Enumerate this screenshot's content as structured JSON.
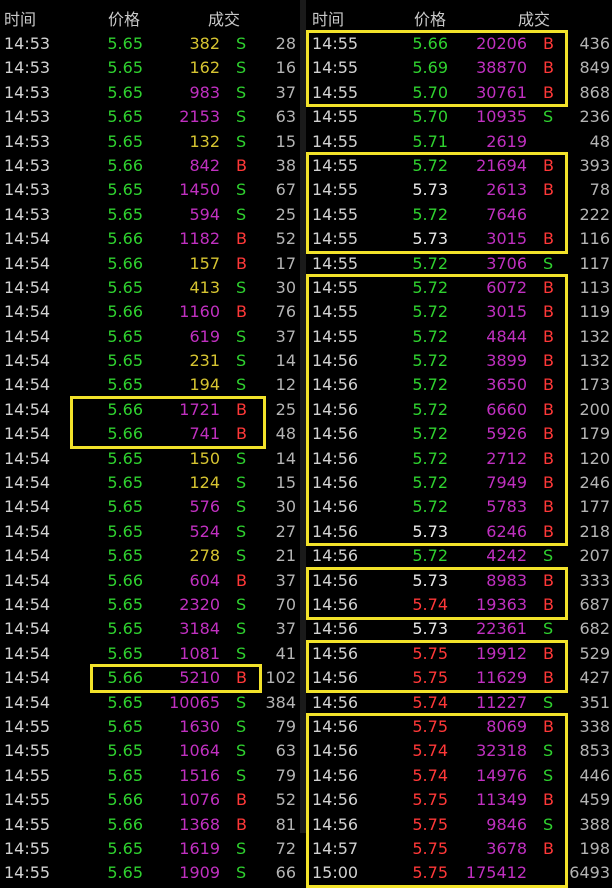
{
  "headers": {
    "time": "时间",
    "price": "价格",
    "volume": "成交"
  },
  "colors": {
    "up": "#ff3838",
    "down": "#2fd12f",
    "flat": "#e8e8e8",
    "vol_small": "#d6c431",
    "vol_large": "#c030c0",
    "side_b": "#ff3838",
    "side_s": "#2fd12f",
    "highlight": "#f2e22a"
  },
  "left_rows": [
    {
      "time": "14:53",
      "price": "5.65",
      "volume": "382",
      "side": "S",
      "count": "28"
    },
    {
      "time": "14:53",
      "price": "5.65",
      "volume": "162",
      "side": "S",
      "count": "16"
    },
    {
      "time": "14:53",
      "price": "5.65",
      "volume": "983",
      "side": "S",
      "count": "37"
    },
    {
      "time": "14:53",
      "price": "5.65",
      "volume": "2153",
      "side": "S",
      "count": "63"
    },
    {
      "time": "14:53",
      "price": "5.65",
      "volume": "132",
      "side": "S",
      "count": "15"
    },
    {
      "time": "14:53",
      "price": "5.66",
      "volume": "842",
      "side": "B",
      "count": "38"
    },
    {
      "time": "14:53",
      "price": "5.65",
      "volume": "1450",
      "side": "S",
      "count": "67"
    },
    {
      "time": "14:53",
      "price": "5.65",
      "volume": "594",
      "side": "S",
      "count": "25"
    },
    {
      "time": "14:54",
      "price": "5.66",
      "volume": "1182",
      "side": "B",
      "count": "52"
    },
    {
      "time": "14:54",
      "price": "5.66",
      "volume": "157",
      "side": "B",
      "count": "17"
    },
    {
      "time": "14:54",
      "price": "5.65",
      "volume": "413",
      "side": "S",
      "count": "30"
    },
    {
      "time": "14:54",
      "price": "5.66",
      "volume": "1160",
      "side": "B",
      "count": "76"
    },
    {
      "time": "14:54",
      "price": "5.65",
      "volume": "619",
      "side": "S",
      "count": "37"
    },
    {
      "time": "14:54",
      "price": "5.65",
      "volume": "231",
      "side": "S",
      "count": "14"
    },
    {
      "time": "14:54",
      "price": "5.65",
      "volume": "194",
      "side": "S",
      "count": "12"
    },
    {
      "time": "14:54",
      "price": "5.66",
      "volume": "1721",
      "side": "B",
      "count": "25"
    },
    {
      "time": "14:54",
      "price": "5.66",
      "volume": "741",
      "side": "B",
      "count": "48"
    },
    {
      "time": "14:54",
      "price": "5.65",
      "volume": "150",
      "side": "S",
      "count": "14"
    },
    {
      "time": "14:54",
      "price": "5.65",
      "volume": "124",
      "side": "S",
      "count": "15"
    },
    {
      "time": "14:54",
      "price": "5.65",
      "volume": "576",
      "side": "S",
      "count": "30"
    },
    {
      "time": "14:54",
      "price": "5.65",
      "volume": "524",
      "side": "S",
      "count": "27"
    },
    {
      "time": "14:54",
      "price": "5.65",
      "volume": "278",
      "side": "S",
      "count": "21"
    },
    {
      "time": "14:54",
      "price": "5.66",
      "volume": "604",
      "side": "B",
      "count": "37"
    },
    {
      "time": "14:54",
      "price": "5.65",
      "volume": "2320",
      "side": "S",
      "count": "70"
    },
    {
      "time": "14:54",
      "price": "5.65",
      "volume": "3184",
      "side": "S",
      "count": "37"
    },
    {
      "time": "14:54",
      "price": "5.65",
      "volume": "1081",
      "side": "S",
      "count": "41"
    },
    {
      "time": "14:54",
      "price": "5.66",
      "volume": "5210",
      "side": "B",
      "count": "102"
    },
    {
      "time": "14:54",
      "price": "5.65",
      "volume": "10065",
      "side": "S",
      "count": "384"
    },
    {
      "time": "14:55",
      "price": "5.65",
      "volume": "1630",
      "side": "S",
      "count": "79"
    },
    {
      "time": "14:55",
      "price": "5.65",
      "volume": "1064",
      "side": "S",
      "count": "63"
    },
    {
      "time": "14:55",
      "price": "5.65",
      "volume": "1516",
      "side": "S",
      "count": "79"
    },
    {
      "time": "14:55",
      "price": "5.66",
      "volume": "1076",
      "side": "B",
      "count": "52"
    },
    {
      "time": "14:55",
      "price": "5.66",
      "volume": "1368",
      "side": "B",
      "count": "81"
    },
    {
      "time": "14:55",
      "price": "5.65",
      "volume": "1619",
      "side": "S",
      "count": "72"
    },
    {
      "time": "14:55",
      "price": "5.65",
      "volume": "1909",
      "side": "S",
      "count": "66"
    }
  ],
  "right_rows": [
    {
      "time": "14:55",
      "price": "5.66",
      "volume": "20206",
      "side": "B",
      "count": "436"
    },
    {
      "time": "14:55",
      "price": "5.69",
      "volume": "38870",
      "side": "B",
      "count": "849"
    },
    {
      "time": "14:55",
      "price": "5.70",
      "volume": "30761",
      "side": "B",
      "count": "868"
    },
    {
      "time": "14:55",
      "price": "5.70",
      "volume": "10935",
      "side": "S",
      "count": "236"
    },
    {
      "time": "14:55",
      "price": "5.71",
      "volume": "2619",
      "side": "",
      "count": "48"
    },
    {
      "time": "14:55",
      "price": "5.72",
      "volume": "21694",
      "side": "B",
      "count": "393"
    },
    {
      "time": "14:55",
      "price": "5.73",
      "volume": "2613",
      "side": "B",
      "count": "78"
    },
    {
      "time": "14:55",
      "price": "5.72",
      "volume": "7646",
      "side": "",
      "count": "222"
    },
    {
      "time": "14:55",
      "price": "5.73",
      "volume": "3015",
      "side": "B",
      "count": "116"
    },
    {
      "time": "14:55",
      "price": "5.72",
      "volume": "3706",
      "side": "S",
      "count": "117"
    },
    {
      "time": "14:55",
      "price": "5.72",
      "volume": "6072",
      "side": "B",
      "count": "113"
    },
    {
      "time": "14:55",
      "price": "5.72",
      "volume": "3015",
      "side": "B",
      "count": "119"
    },
    {
      "time": "14:55",
      "price": "5.72",
      "volume": "4844",
      "side": "B",
      "count": "132"
    },
    {
      "time": "14:56",
      "price": "5.72",
      "volume": "3899",
      "side": "B",
      "count": "132"
    },
    {
      "time": "14:56",
      "price": "5.72",
      "volume": "3650",
      "side": "B",
      "count": "173"
    },
    {
      "time": "14:56",
      "price": "5.72",
      "volume": "6660",
      "side": "B",
      "count": "200"
    },
    {
      "time": "14:56",
      "price": "5.72",
      "volume": "5926",
      "side": "B",
      "count": "179"
    },
    {
      "time": "14:56",
      "price": "5.72",
      "volume": "2712",
      "side": "B",
      "count": "120"
    },
    {
      "time": "14:56",
      "price": "5.72",
      "volume": "7949",
      "side": "B",
      "count": "246"
    },
    {
      "time": "14:56",
      "price": "5.72",
      "volume": "5783",
      "side": "B",
      "count": "177"
    },
    {
      "time": "14:56",
      "price": "5.73",
      "volume": "6246",
      "side": "B",
      "count": "218"
    },
    {
      "time": "14:56",
      "price": "5.72",
      "volume": "4242",
      "side": "S",
      "count": "207"
    },
    {
      "time": "14:56",
      "price": "5.73",
      "volume": "8983",
      "side": "B",
      "count": "333"
    },
    {
      "time": "14:56",
      "price": "5.74",
      "volume": "19363",
      "side": "B",
      "count": "687"
    },
    {
      "time": "14:56",
      "price": "5.73",
      "volume": "22361",
      "side": "S",
      "count": "682"
    },
    {
      "time": "14:56",
      "price": "5.75",
      "volume": "19912",
      "side": "B",
      "count": "529"
    },
    {
      "time": "14:56",
      "price": "5.75",
      "volume": "11629",
      "side": "B",
      "count": "427"
    },
    {
      "time": "14:56",
      "price": "5.74",
      "volume": "11227",
      "side": "S",
      "count": "351"
    },
    {
      "time": "14:56",
      "price": "5.75",
      "volume": "8069",
      "side": "B",
      "count": "338"
    },
    {
      "time": "14:56",
      "price": "5.74",
      "volume": "32318",
      "side": "S",
      "count": "853"
    },
    {
      "time": "14:56",
      "price": "5.74",
      "volume": "14976",
      "side": "S",
      "count": "446"
    },
    {
      "time": "14:56",
      "price": "5.75",
      "volume": "11349",
      "side": "B",
      "count": "459"
    },
    {
      "time": "14:56",
      "price": "5.75",
      "volume": "9846",
      "side": "S",
      "count": "388"
    },
    {
      "time": "14:57",
      "price": "5.75",
      "volume": "3678",
      "side": "B",
      "count": "198"
    },
    {
      "time": "15:00",
      "price": "5.75",
      "volume": "175412",
      "side": "",
      "count": "6493"
    }
  ],
  "highlight_groups": {
    "left": [
      [
        15,
        16
      ],
      [
        26,
        26
      ]
    ],
    "right": [
      [
        0,
        2
      ],
      [
        5,
        8
      ],
      [
        10,
        20
      ],
      [
        22,
        23
      ],
      [
        25,
        26
      ],
      [
        28,
        34
      ]
    ]
  }
}
